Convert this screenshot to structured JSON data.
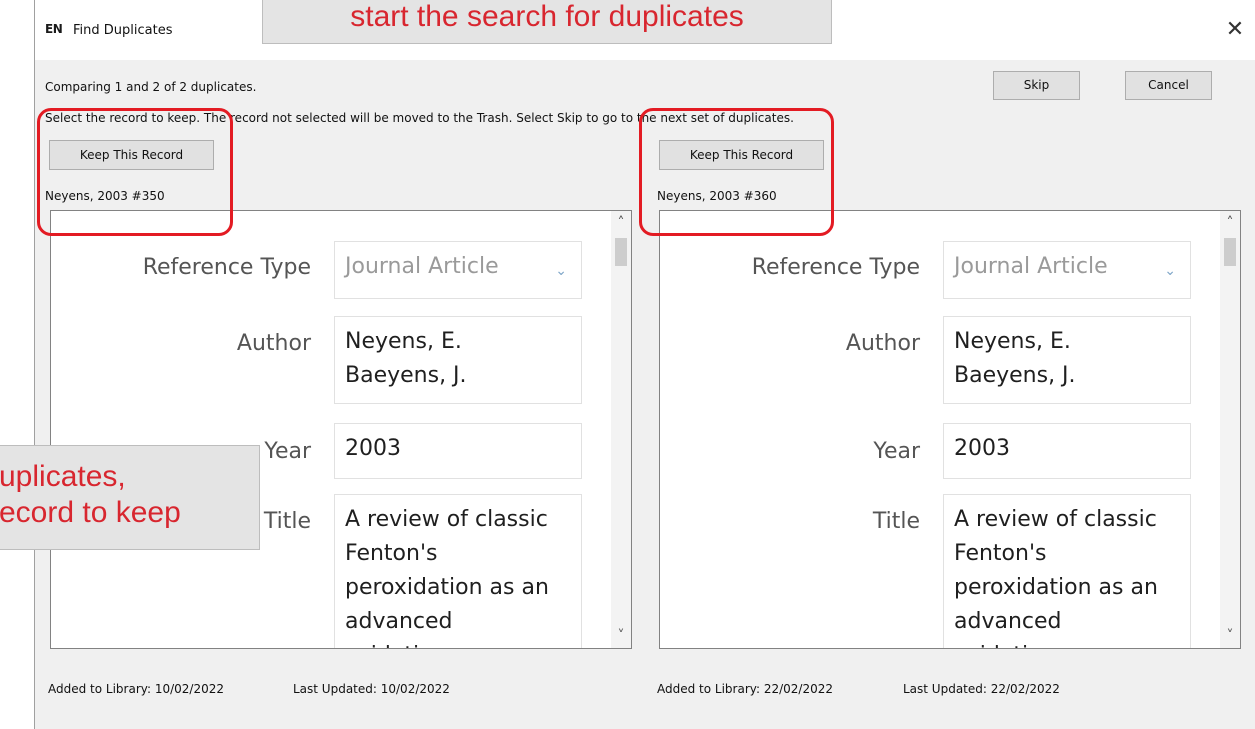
{
  "window": {
    "logo": "EN",
    "title": "Find Duplicates",
    "close_glyph": "✕"
  },
  "header": {
    "status": "Comparing 1 and 2 of 2 duplicates.",
    "instruction": "Select the record to keep. The record not selected will be moved to the Trash. Select Skip to go to the next set of duplicates.",
    "skip_label": "Skip",
    "cancel_label": "Cancel"
  },
  "records": [
    {
      "keep_label": "Keep This Record",
      "id_label": "Neyens, 2003 #350",
      "fields": {
        "reference_type_label": "Reference Type",
        "reference_type_value": "Journal Article",
        "author_label": "Author",
        "author_lines": [
          "Neyens, E.",
          "Baeyens, J."
        ],
        "year_label": "Year",
        "year_value": "2003",
        "title_label": "Title",
        "title_lines": [
          "A review of classic",
          "Fenton's",
          "peroxidation as an",
          "advanced",
          "oxidation"
        ]
      },
      "added_label": "Added to Library: 10/02/2022",
      "updated_label": "Last Updated: 10/02/2022"
    },
    {
      "keep_label": "Keep This Record",
      "id_label": "Neyens, 2003 #360",
      "fields": {
        "reference_type_label": "Reference Type",
        "reference_type_value": "Journal Article",
        "author_label": "Author",
        "author_lines": [
          "Neyens, E.",
          "Baeyens, J."
        ],
        "year_label": "Year",
        "year_value": "2003",
        "title_label": "Title",
        "title_lines": [
          "A review of classic",
          "Fenton's",
          "peroxidation as an",
          "advanced",
          "oxidation"
        ]
      },
      "added_label": "Added to Library: 22/02/2022",
      "updated_label": "Last Updated: 22/02/2022"
    }
  ],
  "callouts": {
    "top_text": "start the search for duplicates",
    "left_lines": [
      "uplicates,",
      "ecord to keep"
    ]
  },
  "colors": {
    "highlight_red": "#e31b23",
    "callout_text": "#d8262f"
  },
  "icons": {
    "dropdown": "chevron-down-icon",
    "scroll_up": "chevron-up-icon",
    "scroll_down": "chevron-down-icon",
    "resize": "resize-grip-icon"
  }
}
